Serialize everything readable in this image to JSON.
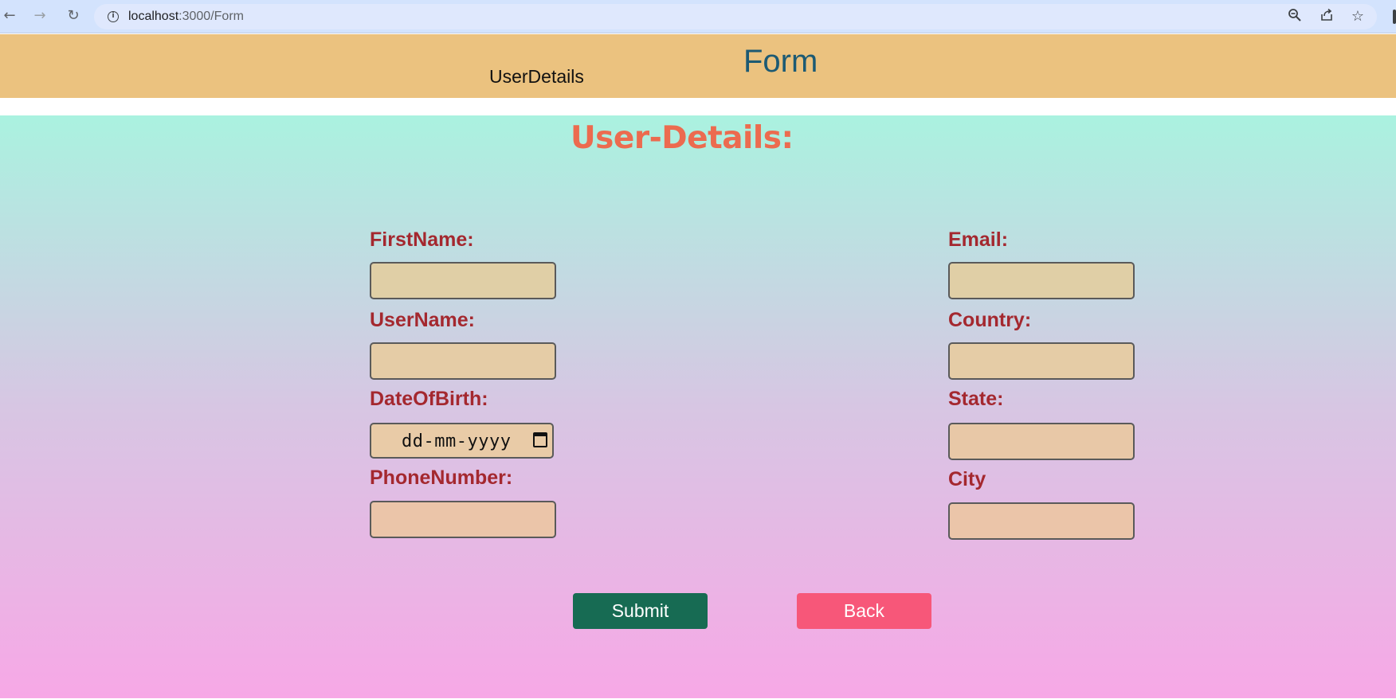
{
  "browser": {
    "url_host": "localhost",
    "url_path": ":3000/Form"
  },
  "header": {
    "nav_link": "UserDetails",
    "title": "Form"
  },
  "form": {
    "heading": "User-Details:",
    "left_fields": [
      {
        "label": "FirstName:",
        "value": ""
      },
      {
        "label": "UserName:",
        "value": ""
      },
      {
        "label": "DateOfBirth:",
        "placeholder": "dd-mm-yyyy"
      },
      {
        "label": "PhoneNumber:",
        "value": ""
      }
    ],
    "right_fields": [
      {
        "label": "Email:",
        "value": ""
      },
      {
        "label": "Country:",
        "value": ""
      },
      {
        "label": "State:",
        "value": ""
      },
      {
        "label": "City",
        "value": ""
      }
    ],
    "submit_label": "Submit",
    "back_label": "Back"
  },
  "icons": [
    "back-arrow-icon",
    "forward-arrow-icon",
    "reload-icon",
    "site-info-icon",
    "zoom-icon",
    "share-icon",
    "star-icon",
    "calendar-icon"
  ],
  "colors": {
    "header_bg": "#ebc27f",
    "title": "#1c5a73",
    "heading": "#ec6b4f",
    "label": "#a4282f",
    "submit_bg": "#176b53",
    "back_bg": "#f75779"
  }
}
